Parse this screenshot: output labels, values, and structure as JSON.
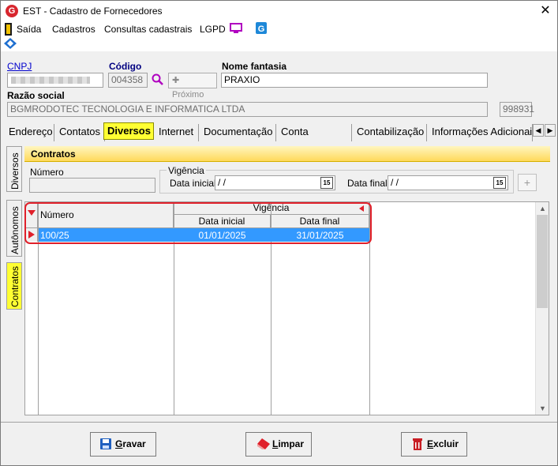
{
  "window": {
    "title": "EST - Cadastro de Fornecedores",
    "app_icon": "G",
    "close": "✕"
  },
  "menu": {
    "saida": "Saída",
    "cadastros": "Cadastros",
    "consultas": "Consultas cadastrais",
    "lgpd": "LGPD"
  },
  "form": {
    "cnpj_label": "CNPJ",
    "cnpj_value": "",
    "codigo_label": "Código",
    "codigo_value": "004358",
    "proximo_label": "Próximo",
    "nome_fantasia_label": "Nome fantasia",
    "nome_fantasia_value": "PRAXIO",
    "razao_social_label": "Razão social",
    "razao_social_value": "BGMRODOTEC TECNOLOGIA E INFORMATICA LTDA",
    "extra_code": "998931"
  },
  "tabs": [
    "Endereço",
    "Contatos",
    "Diversos",
    "Internet",
    "Documentação",
    "Conta corrente",
    "Contabilização",
    "Informações Adicionai"
  ],
  "active_tab": "Diversos",
  "vtabs": [
    "Diversos",
    "Autônomos",
    "Contratos"
  ],
  "contratos": {
    "header": "Contratos",
    "numero_label": "Número",
    "numero_value": "",
    "vigencia_label": "Vigência",
    "data_inicial_label": "Data inicial",
    "data_inicial_value": "/ /",
    "data_final_label": "Data final",
    "data_final_value": "/ /",
    "calendar": "15",
    "add_button": "+"
  },
  "grid": {
    "col_numero": "Número",
    "group_vigencia": "Vigência",
    "col_data_inicial": "Data inicial",
    "col_data_final": "Data final",
    "rows": [
      {
        "numero": "100/25",
        "data_inicial": "01/01/2025",
        "data_final": "31/01/2025"
      }
    ],
    "selection_color": "#3399ff"
  },
  "buttons": {
    "gravar_first": "G",
    "gravar_rest": "ravar",
    "limpar_first": "L",
    "limpar_rest": "impar",
    "excluir_first": "E",
    "excluir_rest": "xcluir"
  },
  "colors": {
    "active_tab": "#ffff33",
    "highlight": "#e0202a",
    "link": "#0000cc"
  }
}
